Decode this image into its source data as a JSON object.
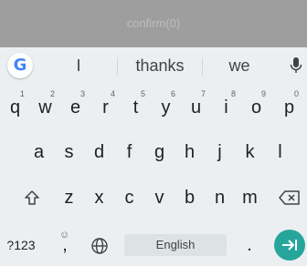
{
  "confirm": {
    "label": "confirm(0)"
  },
  "suggestions": {
    "items": [
      "I",
      "thanks",
      "we"
    ],
    "logo_text": "G"
  },
  "keyboard": {
    "row1": [
      {
        "label": "q",
        "hint": "1"
      },
      {
        "label": "w",
        "hint": "2"
      },
      {
        "label": "e",
        "hint": "3"
      },
      {
        "label": "r",
        "hint": "4"
      },
      {
        "label": "t",
        "hint": "5"
      },
      {
        "label": "y",
        "hint": "6"
      },
      {
        "label": "u",
        "hint": "7"
      },
      {
        "label": "i",
        "hint": "8"
      },
      {
        "label": "o",
        "hint": "9"
      },
      {
        "label": "p",
        "hint": "0"
      }
    ],
    "row2": [
      "a",
      "s",
      "d",
      "f",
      "g",
      "h",
      "j",
      "k",
      "l"
    ],
    "row3": [
      "z",
      "x",
      "c",
      "v",
      "b",
      "n",
      "m"
    ],
    "bottom": {
      "symbols_label": "?123",
      "comma_label": ",",
      "emoji_hint": "☺",
      "space_label": "English",
      "period_label": "."
    },
    "accent_color": "#26a69a",
    "icons": [
      "shift-icon",
      "backspace-icon",
      "globe-icon",
      "enter-icon",
      "mic-icon"
    ]
  }
}
